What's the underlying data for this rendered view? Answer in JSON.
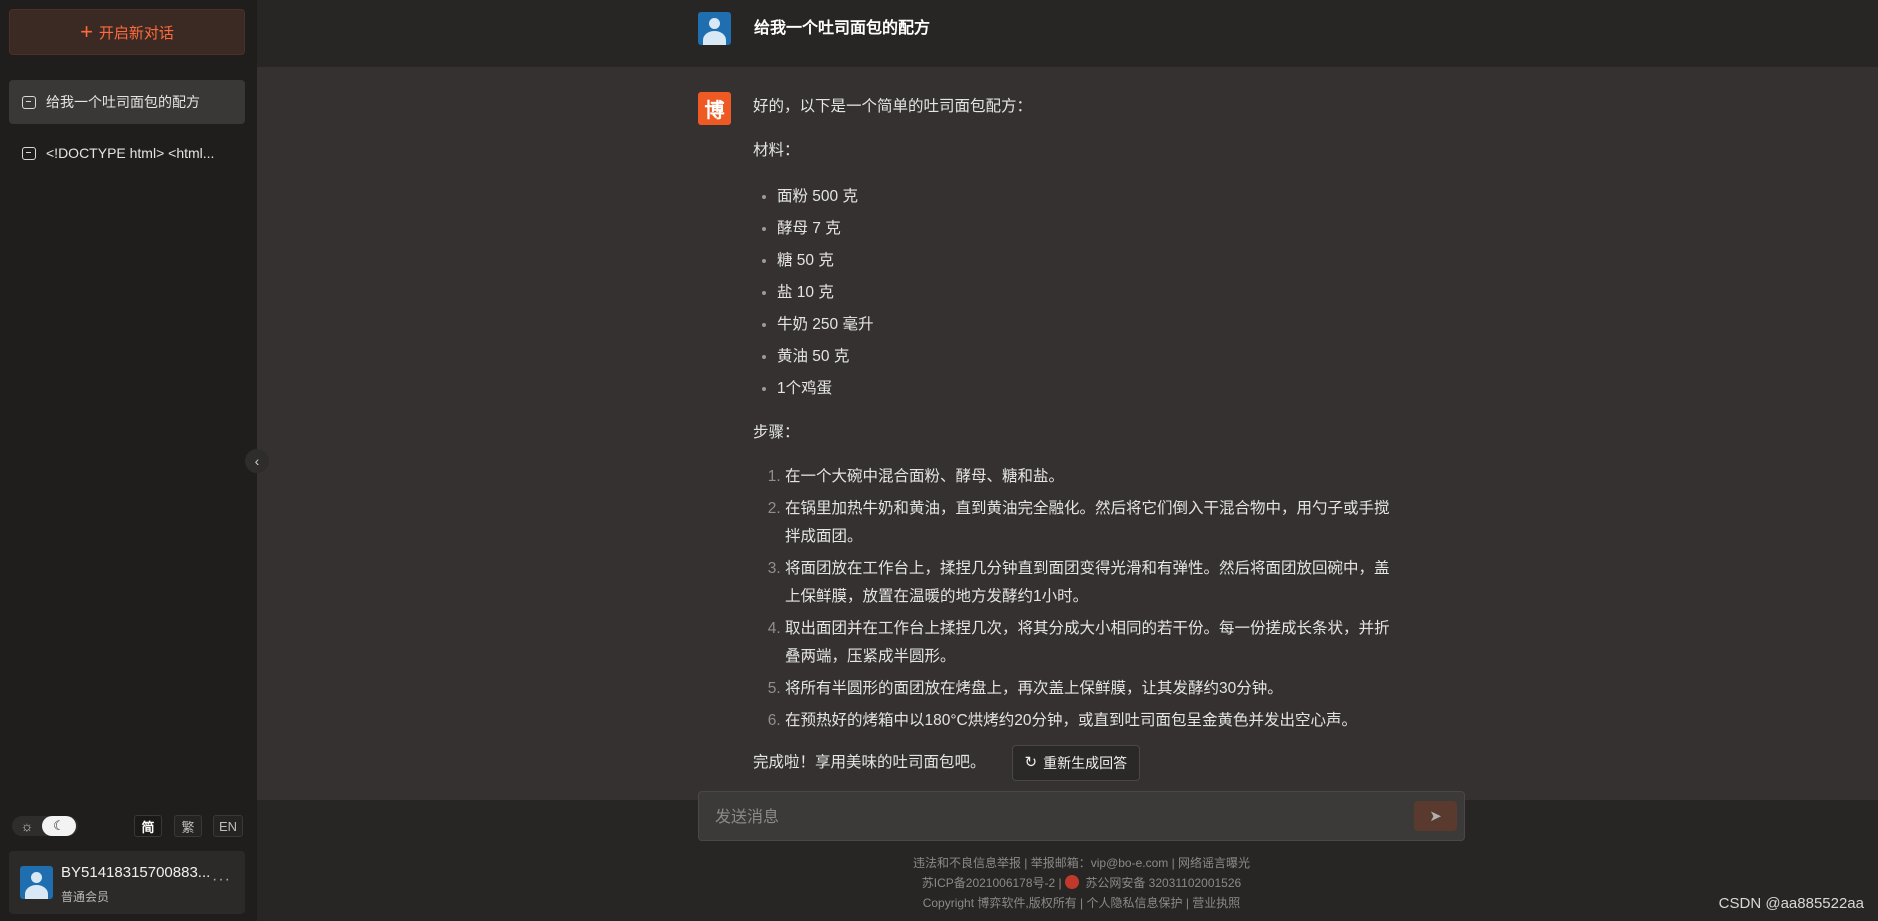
{
  "sidebar": {
    "new_chat_label": "开启新对话",
    "conversations": [
      {
        "label": "给我一个吐司面包的配方",
        "active": true
      },
      {
        "label": "<!DOCTYPE html> <html...",
        "active": false
      }
    ],
    "languages": [
      "简",
      "繁",
      "EN"
    ],
    "selected_language": "简",
    "user": {
      "name": "BY51418315700883...",
      "level": "普通会员",
      "more": "···"
    }
  },
  "chat": {
    "user_message": "给我一个吐司面包的配方",
    "bot_avatar_char": "博",
    "answer": {
      "intro": "好的，以下是一个简单的吐司面包配方：",
      "materials_heading": "材料：",
      "materials": [
        "面粉 500 克",
        "酵母 7 克",
        "糖 50 克",
        "盐 10 克",
        "牛奶 250 毫升",
        "黄油 50 克",
        "1个鸡蛋"
      ],
      "steps_heading": "步骤：",
      "steps": [
        "在一个大碗中混合面粉、酵母、糖和盐。",
        "在锅里加热牛奶和黄油，直到黄油完全融化。然后将它们倒入干混合物中，用勺子或手搅拌成面团。",
        "将面团放在工作台上，揉捏几分钟直到面团变得光滑和有弹性。然后将面团放回碗中，盖上保鲜膜，放置在温暖的地方发酵约1小时。",
        "取出面团并在工作台上揉捏几次，将其分成大小相同的若干份。每一份搓成长条状，并折叠两端，压紧成半圆形。",
        "将所有半圆形的面团放在烤盘上，再次盖上保鲜膜，让其发酵约30分钟。",
        "在预热好的烤箱中以180°C烘烤约20分钟，或直到吐司面包呈金黄色并发出空心声。"
      ],
      "closing": "完成啦！享用美味的吐司面包吧。"
    },
    "regenerate_label": "重新生成回答"
  },
  "input": {
    "placeholder": "发送消息"
  },
  "footer": {
    "line1": "违法和不良信息举报 | 举报邮箱：vip@bo-e.com | 网络谣言曝光",
    "line2_icp": "苏ICP备2021006178号-2 |",
    "line2_police": "苏公网安备 32031102001526",
    "line3": "Copyright 博弈软件,版权所有 | 个人隐私信息保护 | 营业执照"
  },
  "watermark": "CSDN @aa885522aa",
  "colors": {
    "accent": "#ff6a3d",
    "sidebar_bg": "#201e1d",
    "main_bg": "#343130",
    "bot_avatar": "#ef5a24",
    "user_avatar": "#1f6fb0"
  }
}
